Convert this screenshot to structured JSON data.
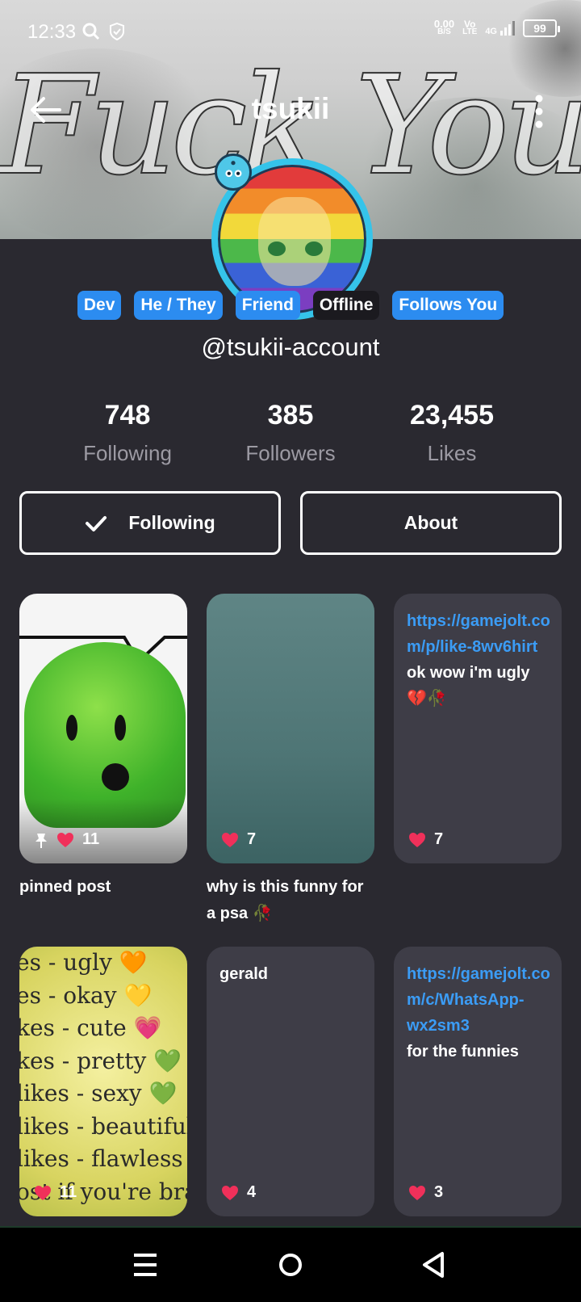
{
  "status_bar": {
    "time": "12:33",
    "net_speed_value": "0.00",
    "net_speed_unit": "B/S",
    "volte_top": "Vo",
    "volte_bottom": "LTE",
    "network": "4G",
    "battery": "99"
  },
  "header": {
    "title": "tsukii",
    "banner_text": "Fuck You"
  },
  "profile": {
    "tags": [
      {
        "label": "Dev",
        "style": "blue"
      },
      {
        "label": "He / They",
        "style": "blue"
      },
      {
        "label": "Friend",
        "style": "blue"
      },
      {
        "label": "Offline",
        "style": "dark"
      },
      {
        "label": "Follows You",
        "style": "blue"
      }
    ],
    "handle": "@tsukii-account",
    "stats": {
      "following_count": "748",
      "following_label": "Following",
      "followers_count": "385",
      "followers_label": "Followers",
      "likes_count": "23,455",
      "likes_label": "Likes"
    },
    "buttons": {
      "following": "Following",
      "about": "About"
    }
  },
  "posts": [
    {
      "type": "image",
      "likes": "11",
      "pinned": true,
      "caption": "pinned post"
    },
    {
      "type": "image",
      "likes": "7",
      "caption": "why is this funny for a psa 🥀"
    },
    {
      "type": "text",
      "link": "https://gamejolt.com/p/like-8wv6hirt",
      "body": "ok wow i'm ugly 💔🥀",
      "likes": "7"
    },
    {
      "type": "image",
      "likes": "11",
      "image_lines": [
        "es - ugly 🧡",
        "es - okay 💛",
        "kes - cute 💗",
        "kes - pretty 💚",
        "likes - sexy 💚",
        "likes - beautiful",
        "likes - flawless 💜",
        "ost if you're bra"
      ]
    },
    {
      "type": "text",
      "body": "gerald",
      "likes": "4"
    },
    {
      "type": "text",
      "link": "https://gamejolt.com/c/WhatsApp-wx2sm3",
      "body": "for the funnies",
      "likes": "3"
    }
  ],
  "colors": {
    "background": "#2a2930",
    "accent_blue": "#2c8cf0",
    "link_blue": "#3b9cf5",
    "heart_pink": "#f0305a",
    "card_bg": "#3e3d47"
  }
}
